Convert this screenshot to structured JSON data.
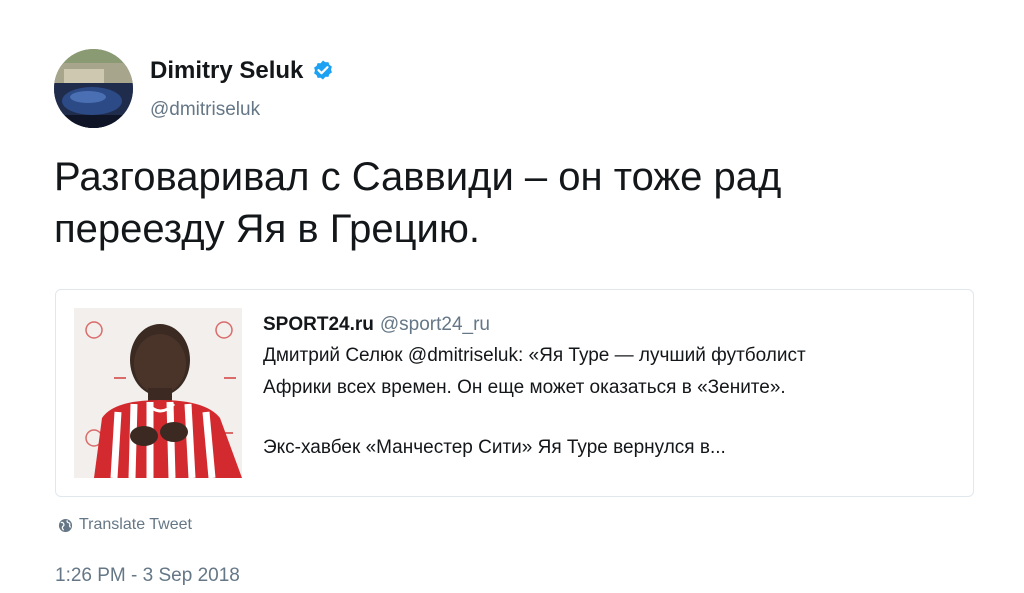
{
  "author": {
    "display_name": "Dimitry Seluk",
    "handle": "@dmitriseluk",
    "verified": true,
    "verified_icon": "verified-badge-icon",
    "verified_color": "#1da1f2"
  },
  "tweet": {
    "text": "Разговаривал с Саввиди – он тоже рад переезду Яя в Грецию."
  },
  "quoted_card": {
    "source_name": "SPORT24.ru",
    "source_handle": "@sport24_ru",
    "line1": "Дмитрий Селюк @dmitriseluk: «Яя Туре — лучший футболист",
    "line2": "Африки всех времен. Он еще может оказаться в «Зените».",
    "line3": "Экс-хавбек «Манчестер Сити» Яя Туре вернулся в..."
  },
  "translate": {
    "label": "Translate Tweet",
    "icon": "globe-icon"
  },
  "timestamp": "1:26 PM - 3 Sep 2018",
  "colors": {
    "text_primary": "#14171a",
    "text_secondary": "#657786",
    "border": "#e1e8ed",
    "jersey_red": "#d32a2f"
  }
}
